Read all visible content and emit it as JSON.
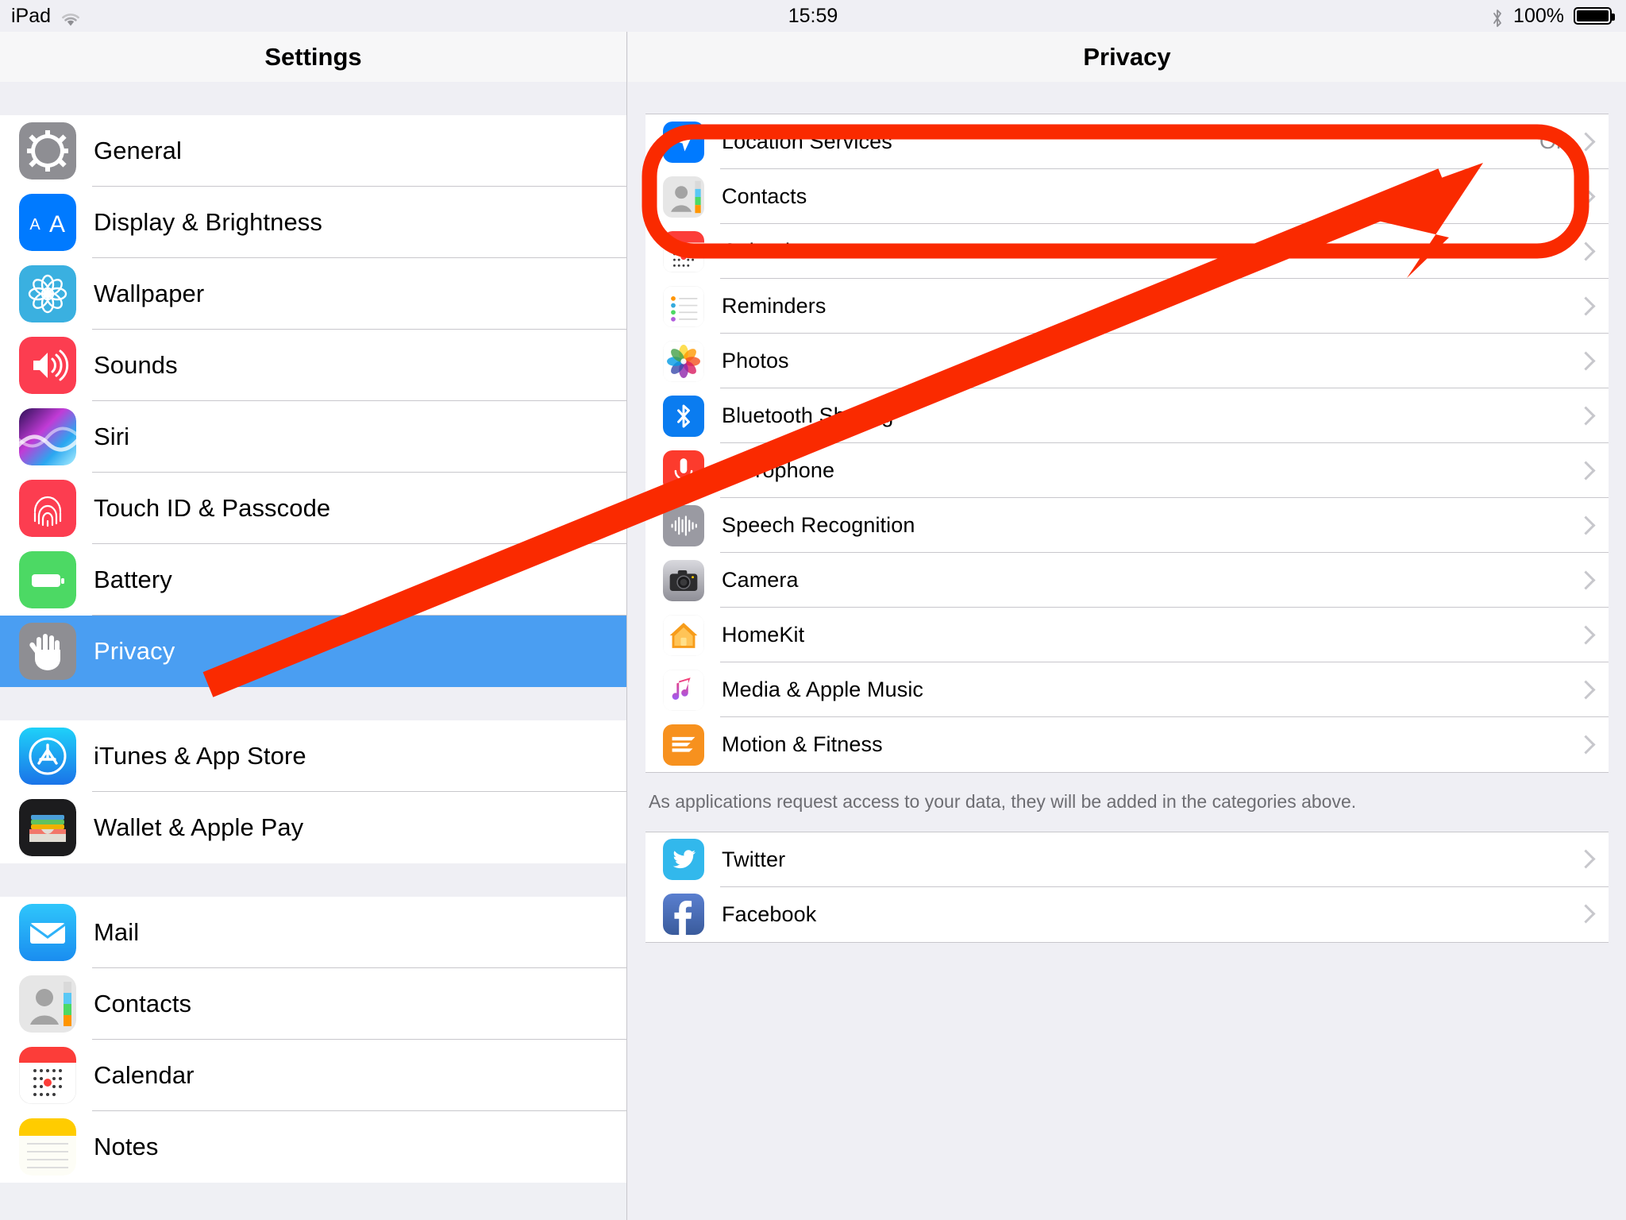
{
  "statusbar": {
    "device": "iPad",
    "wifi_icon": "wifi-icon",
    "time": "15:59",
    "bluetooth_icon": "bluetooth-icon",
    "battery_percent": "100%",
    "battery_icon": "battery-full-icon"
  },
  "sidebar": {
    "title": "Settings",
    "groups": [
      {
        "items": [
          {
            "label": "General",
            "icon": "gear-icon"
          },
          {
            "label": "Display & Brightness",
            "icon": "text-size-icon"
          },
          {
            "label": "Wallpaper",
            "icon": "flower-icon"
          },
          {
            "label": "Sounds",
            "icon": "speaker-icon"
          },
          {
            "label": "Siri",
            "icon": "siri-icon"
          },
          {
            "label": "Touch ID & Passcode",
            "icon": "fingerprint-icon"
          },
          {
            "label": "Battery",
            "icon": "battery-icon"
          },
          {
            "label": "Privacy",
            "icon": "hand-icon",
            "selected": true
          }
        ]
      },
      {
        "items": [
          {
            "label": "iTunes & App Store",
            "icon": "app-store-icon"
          },
          {
            "label": "Wallet & Apple Pay",
            "icon": "wallet-icon"
          }
        ]
      },
      {
        "items": [
          {
            "label": "Mail",
            "icon": "mail-icon"
          },
          {
            "label": "Contacts",
            "icon": "contacts-icon"
          },
          {
            "label": "Calendar",
            "icon": "calendar-icon"
          },
          {
            "label": "Notes",
            "icon": "notes-icon"
          }
        ]
      }
    ]
  },
  "detail": {
    "title": "Privacy",
    "card1": [
      {
        "label": "Location Services",
        "icon": "location-arrow-icon",
        "value": "On"
      },
      {
        "label": "Contacts",
        "icon": "contacts-icon"
      },
      {
        "label": "Calendars",
        "icon": "calendar-icon"
      },
      {
        "label": "Reminders",
        "icon": "reminders-icon"
      },
      {
        "label": "Photos",
        "icon": "photos-icon"
      },
      {
        "label": "Bluetooth Sharing",
        "icon": "bluetooth-icon"
      },
      {
        "label": "Microphone",
        "icon": "microphone-icon"
      },
      {
        "label": "Speech Recognition",
        "icon": "waveform-icon"
      },
      {
        "label": "Camera",
        "icon": "camera-icon"
      },
      {
        "label": "HomeKit",
        "icon": "home-icon"
      },
      {
        "label": "Media & Apple Music",
        "icon": "music-note-icon"
      },
      {
        "label": "Motion & Fitness",
        "icon": "motion-icon"
      }
    ],
    "footnote": "As applications request access to your data, they will be added in the categories above.",
    "card2": [
      {
        "label": "Twitter",
        "icon": "twitter-icon"
      },
      {
        "label": "Facebook",
        "icon": "facebook-icon"
      }
    ]
  },
  "annotations": {
    "highlight_color": "#FA2A00",
    "highlight_shape": "rounded-rectangle",
    "pointer_shape": "arrow",
    "highlight_target": "Location Services",
    "pointer_from": "Privacy"
  }
}
